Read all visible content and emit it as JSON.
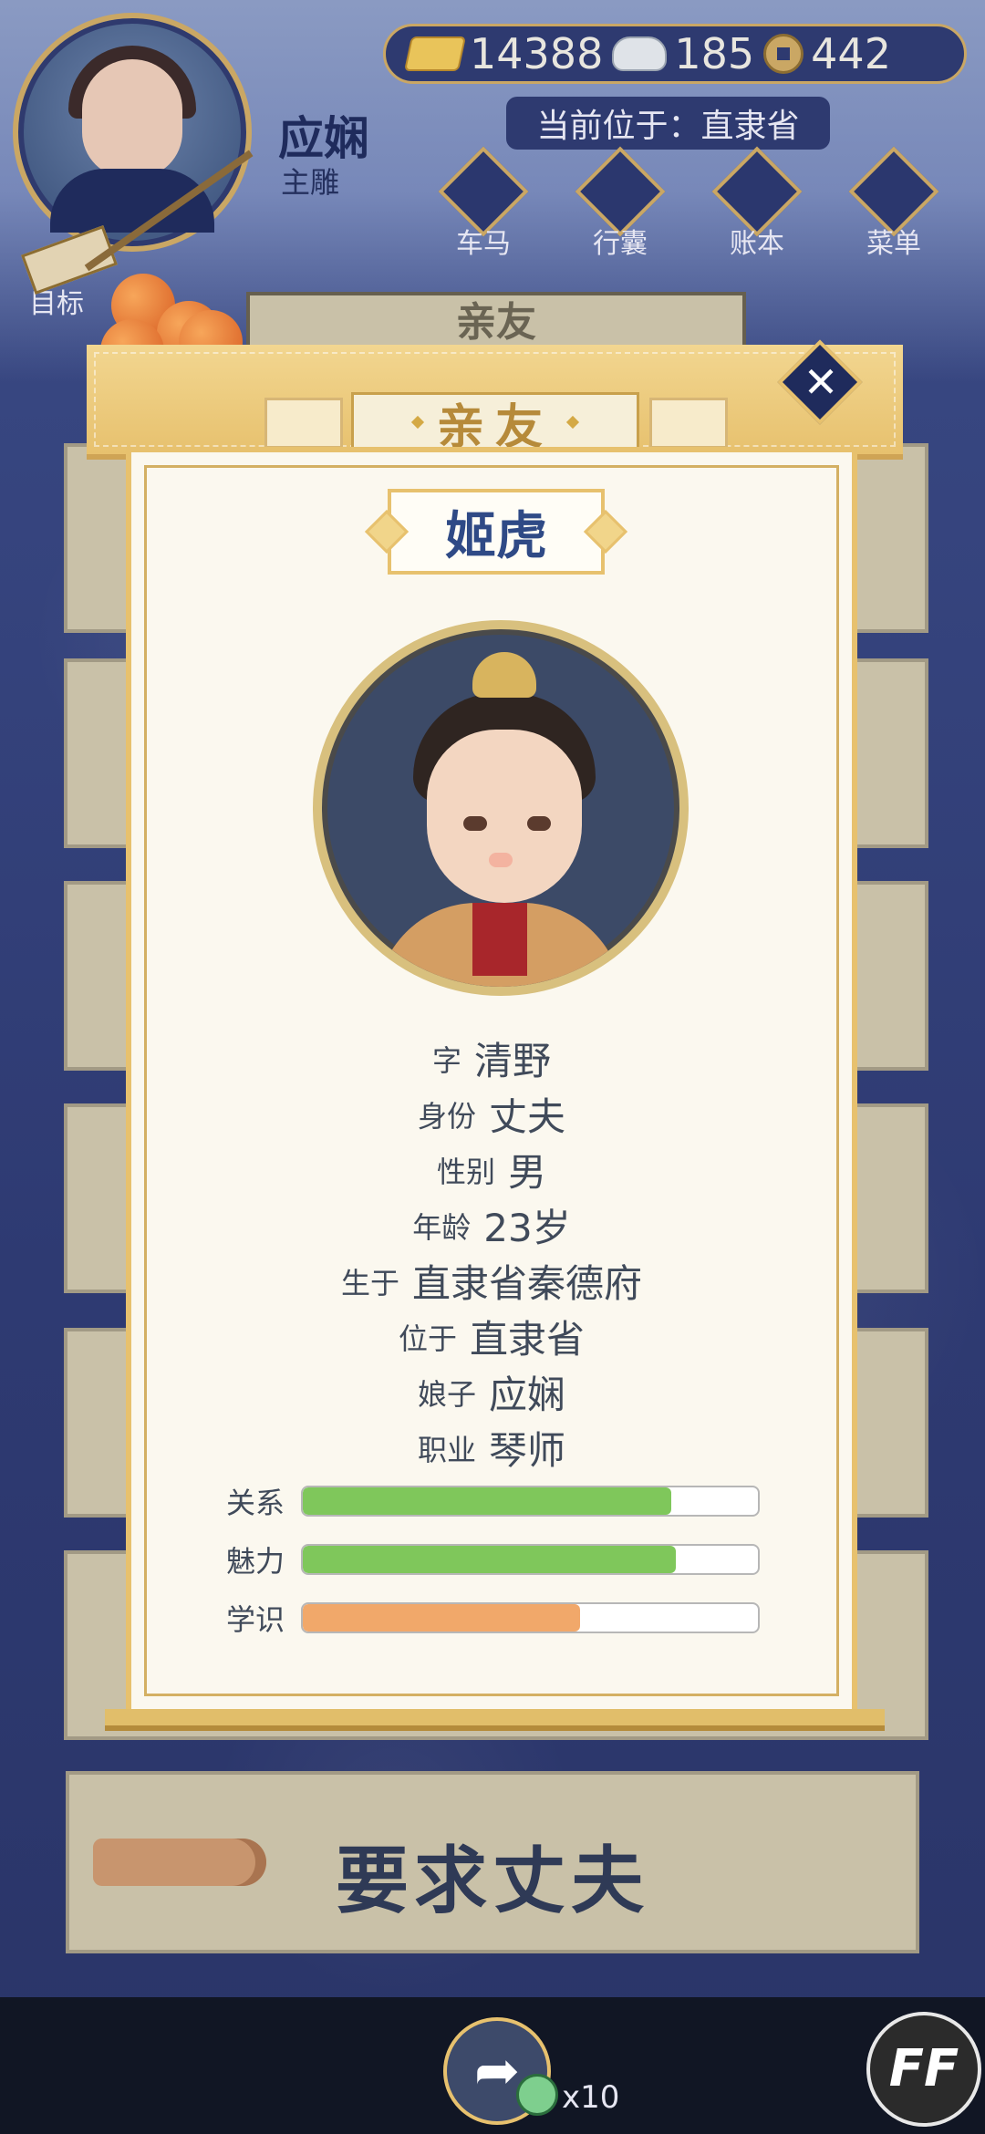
{
  "hud": {
    "player_name": "应娴",
    "player_role": "主雕",
    "currency": {
      "gold": "14388",
      "silver": "185",
      "coins": "442"
    },
    "location": "当前位于：直隶省",
    "menu": [
      "车马",
      "行囊",
      "账本",
      "菜单"
    ],
    "goal_label": "目标"
  },
  "background": {
    "title": "亲友"
  },
  "modal": {
    "title": "亲友",
    "name": "姬虎",
    "info": [
      {
        "label": "字",
        "value": "清野"
      },
      {
        "label": "身份",
        "value": "丈夫"
      },
      {
        "label": "性别",
        "value": "男"
      },
      {
        "label": "年龄",
        "value": "23岁"
      },
      {
        "label": "生于",
        "value": "直隶省秦德府"
      },
      {
        "label": "位于",
        "value": "直隶省"
      },
      {
        "label": "娘子",
        "value": "应娴"
      },
      {
        "label": "职业",
        "value": "琴师"
      }
    ],
    "stats": [
      {
        "label": "关系",
        "value": 0.81,
        "color": "#7fc75b"
      },
      {
        "label": "魅力",
        "value": 0.82,
        "color": "#7fc75b"
      },
      {
        "label": "学识",
        "value": 0.61,
        "color": "#f1a86a"
      }
    ]
  },
  "action_button": {
    "label": "要求丈夫"
  },
  "bottom": {
    "multiplier": "x10",
    "ff_label": "FF"
  },
  "icons": {
    "gold": "gold-ingot-icon",
    "silver": "silver-ingot-icon",
    "coin": "copper-coin-icon",
    "close": "close-icon",
    "share": "share-icon",
    "jade": "jade-token-icon",
    "hand": "pointing-hand-icon"
  }
}
